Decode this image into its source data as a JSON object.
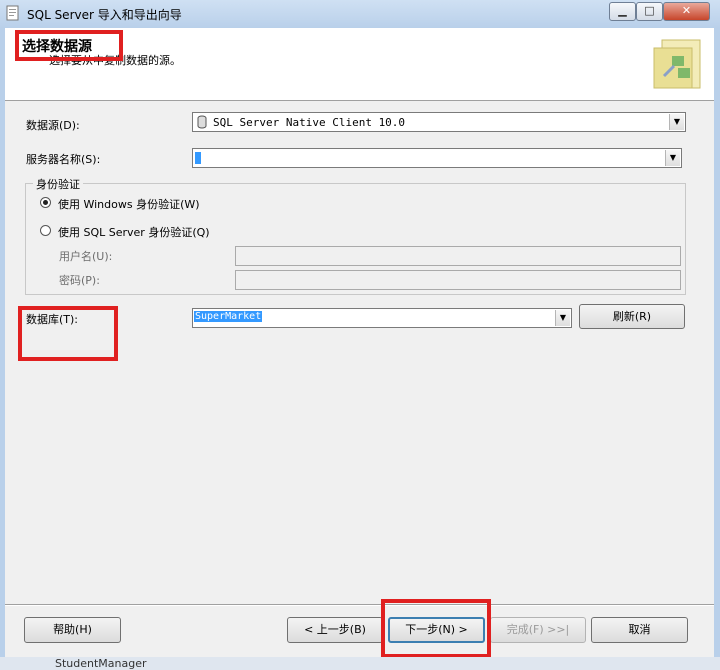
{
  "window": {
    "title": "SQL Server 导入和导出向导",
    "min_label": "▁",
    "max_label": "□",
    "close_label": "✕"
  },
  "header": {
    "title": "选择数据源",
    "subtitle": "选择要从中复制数据的源。"
  },
  "form": {
    "datasource_label": "数据源(D):",
    "datasource_value": "SQL Server Native Client 10.0",
    "server_label": "服务器名称(S):",
    "server_value": "",
    "auth_group_title": "身份验证",
    "auth_windows_label": "使用 Windows 身份验证(W)",
    "auth_sql_label": "使用 SQL Server 身份验证(Q)",
    "username_label": "用户名(U):",
    "password_label": "密码(P):",
    "database_label": "数据库(T):",
    "database_value": "SuperMarket",
    "refresh_label": "刷新(R)",
    "auth_selected": "windows"
  },
  "buttons": {
    "help": "帮助(H)",
    "back": "< 上一步(B)",
    "next": "下一步(N) >",
    "finish": "完成(F) >>|",
    "cancel": "取消"
  },
  "taskbar": {
    "item": "StudentManager"
  },
  "colors": {
    "highlight_red": "#e02020",
    "selection_blue": "#3399ff"
  }
}
